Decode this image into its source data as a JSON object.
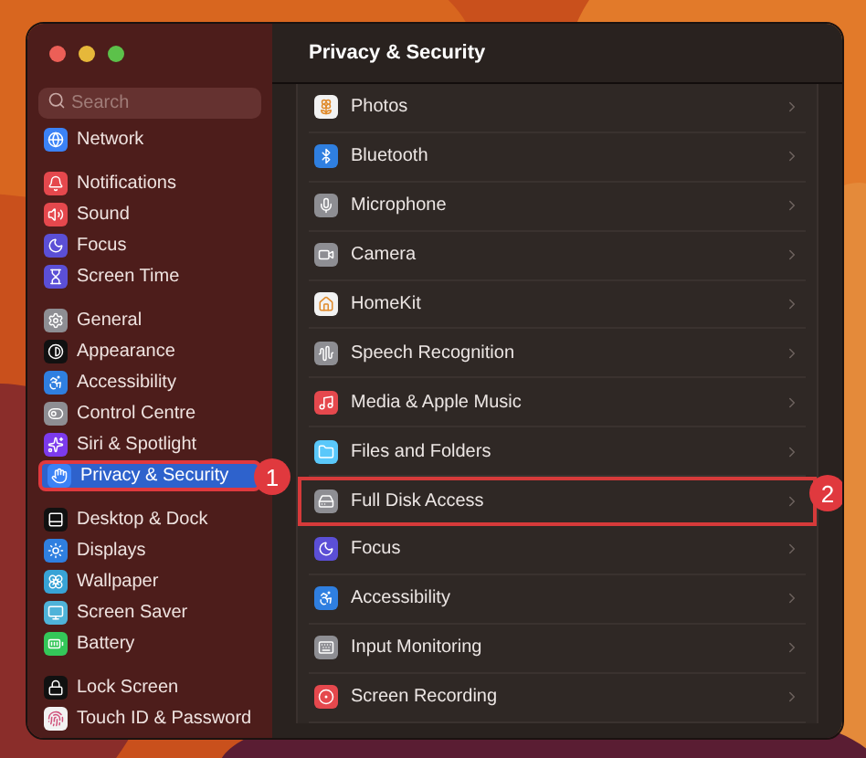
{
  "window": {
    "title": "Privacy & Security"
  },
  "search": {
    "placeholder": "Search"
  },
  "sidebar": {
    "groups": [
      [
        {
          "label": "Network",
          "selected": false,
          "color": "#3b82f6"
        }
      ],
      [
        {
          "label": "Notifications",
          "selected": false,
          "color": "#e5484d"
        },
        {
          "label": "Sound",
          "selected": false,
          "color": "#e5484d"
        },
        {
          "label": "Focus",
          "selected": false,
          "color": "#5b4fd6"
        },
        {
          "label": "Screen Time",
          "selected": false,
          "color": "#5b4fd6"
        }
      ],
      [
        {
          "label": "General",
          "selected": false,
          "color": "#8e8e93"
        },
        {
          "label": "Appearance",
          "selected": false,
          "color": "#111111"
        },
        {
          "label": "Accessibility",
          "selected": false,
          "color": "#2f7fe0"
        },
        {
          "label": "Control Centre",
          "selected": false,
          "color": "#8e8e93"
        },
        {
          "label": "Siri & Spotlight",
          "selected": false,
          "color": "#7c3aed"
        },
        {
          "label": "Privacy & Security",
          "selected": true,
          "color": "#3b82f6",
          "callout": "1"
        }
      ],
      [
        {
          "label": "Desktop & Dock",
          "selected": false,
          "color": "#111111"
        },
        {
          "label": "Displays",
          "selected": false,
          "color": "#2f7fe0"
        },
        {
          "label": "Wallpaper",
          "selected": false,
          "color": "#38a3d6"
        },
        {
          "label": "Screen Saver",
          "selected": false,
          "color": "#4fb3d9"
        },
        {
          "label": "Battery",
          "selected": false,
          "color": "#34c759"
        }
      ],
      [
        {
          "label": "Lock Screen",
          "selected": false,
          "color": "#111111"
        },
        {
          "label": "Touch ID & Password",
          "selected": false,
          "color": "#f2f2f2"
        }
      ]
    ]
  },
  "privacy_list": [
    {
      "label": "Photos",
      "color": "#f2f2f2"
    },
    {
      "label": "Bluetooth",
      "color": "#2f7fe0"
    },
    {
      "label": "Microphone",
      "color": "#8e8e93"
    },
    {
      "label": "Camera",
      "color": "#8e8e93"
    },
    {
      "label": "HomeKit",
      "color": "#f2f2f2"
    },
    {
      "label": "Speech Recognition",
      "color": "#8e8e93"
    },
    {
      "label": "Media & Apple Music",
      "color": "#e5484d"
    },
    {
      "label": "Files and Folders",
      "color": "#5ac8fa"
    },
    {
      "label": "Full Disk Access",
      "color": "#8e8e93",
      "callout": "2"
    },
    {
      "label": "Focus",
      "color": "#5b4fd6"
    },
    {
      "label": "Accessibility",
      "color": "#2f7fe0"
    },
    {
      "label": "Input Monitoring",
      "color": "#8e8e93"
    },
    {
      "label": "Screen Recording",
      "color": "#e5484d"
    }
  ]
}
